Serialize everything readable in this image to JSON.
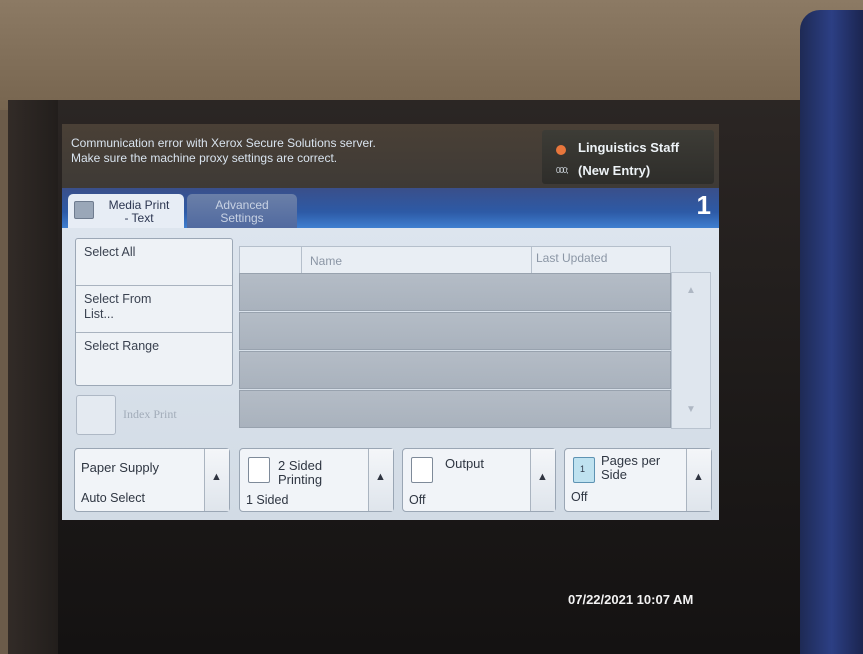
{
  "banner": {
    "message_line1": "Communication error with Xerox Secure Solutions server.",
    "message_line2": "Make sure the machine proxy settings are correct."
  },
  "user": {
    "name": "Linguistics Staff",
    "entry": "(New Entry)",
    "entry_icon_glyph": "000;"
  },
  "tabs": {
    "media_print_line1": "Media Print",
    "media_print_line2": "- Text",
    "advanced_line1": "Advanced",
    "advanced_line2": "Settings",
    "screen_number": "1"
  },
  "select": {
    "select_all": "Select All",
    "select_from_list_line1": "Select From",
    "select_from_list_line2": "List...",
    "select_range": "Select Range",
    "index_print": "Index Print"
  },
  "list": {
    "col_name": "Name",
    "col_last_updated": "Last Updated",
    "scroll_up_glyph": "▲",
    "scroll_down_glyph": "▼"
  },
  "controls": {
    "paper_supply_title": "Paper Supply",
    "paper_supply_value": "Auto Select",
    "two_sided_line1": "2 Sided",
    "two_sided_line2": "Printing",
    "two_sided_value": "1 Sided",
    "output_title": "Output",
    "output_value": "Off",
    "pages_per_side_line1": "Pages per",
    "pages_per_side_line2": "Side",
    "pages_per_side_value": "Off",
    "pages_per_side_box": "1",
    "arrow_glyph": "▲"
  },
  "clock": {
    "datetime": "07/22/2021  10:07 AM"
  },
  "colors": {
    "tab_blue": "#2d5aa6",
    "screen_bg": "#dde5ee",
    "row_gray": "#a9b2bd"
  }
}
